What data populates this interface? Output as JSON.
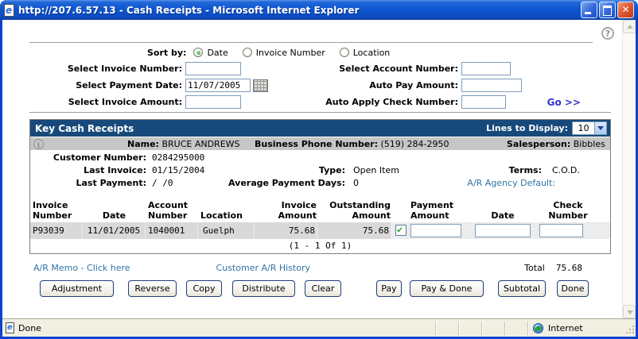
{
  "window": {
    "title": "http://207.6.57.13 - Cash Receipts - Microsoft Internet Explorer"
  },
  "icons": {
    "ie": "e",
    "help": "?",
    "info": "i"
  },
  "colors": {
    "titlebar_blue": "#0f55d0",
    "panel_header_navy": "#17497B",
    "name_bar_gray": "#C6C6C6",
    "row_gray": "#D9D9D9",
    "link_steel_blue": "#2E74A4",
    "go_link_blue": "#3333CC",
    "checkmark_green": "#2BA32B"
  },
  "sort": {
    "label": "Sort by:",
    "options": [
      {
        "label": "Date",
        "selected": true
      },
      {
        "label": "Invoice Number",
        "selected": false
      },
      {
        "label": "Location",
        "selected": false
      }
    ]
  },
  "filters": {
    "invoice_number": {
      "label": "Select Invoice Number:",
      "value": ""
    },
    "payment_date": {
      "label": "Select Payment Date:",
      "value": "11/07/2005"
    },
    "invoice_amount": {
      "label": "Select Invoice Amount:",
      "value": ""
    },
    "account_number": {
      "label": "Select Account Number:",
      "value": ""
    },
    "auto_pay_amount": {
      "label": "Auto Pay Amount:",
      "value": ""
    },
    "auto_apply_check": {
      "label": "Auto Apply Check Number:",
      "value": ""
    },
    "go_label": "Go >>"
  },
  "panel": {
    "title": "Key Cash Receipts",
    "lines_to_display": {
      "label": "Lines to Display:",
      "value": "10"
    },
    "customer": {
      "name_label": "Name:",
      "name": "BRUCE ANDREWS",
      "phone_label": "Business Phone Number:",
      "phone": "(519) 284-2950",
      "salesperson_label": "Salesperson:",
      "salesperson": "Bibbles",
      "customer_number_label": "Customer Number:",
      "customer_number": "0284295000",
      "last_invoice_label": "Last Invoice:",
      "last_invoice": "01/15/2004",
      "type_label": "Type:",
      "type": "Open Item",
      "terms_label": "Terms:",
      "terms": "C.O.D.",
      "last_payment_label": "Last Payment:",
      "last_payment": "/ /0",
      "avg_payment_days_label": "Average Payment Days:",
      "avg_payment_days": "0",
      "ar_agency_default_label": "A/R Agency Default:"
    },
    "table": {
      "headers": [
        {
          "line1": "Invoice",
          "line2": "Number"
        },
        {
          "line1": "",
          "line2": "Date"
        },
        {
          "line1": "Account",
          "line2": "Number"
        },
        {
          "line1": "",
          "line2": "Location"
        },
        {
          "line1": "Invoice",
          "line2": "Amount"
        },
        {
          "line1": "Outstanding",
          "line2": "Amount"
        },
        {
          "line1": "Payment",
          "line2": "Amount"
        },
        {
          "line1": "",
          "line2": "Date"
        },
        {
          "line1": "Check",
          "line2": "Number"
        }
      ],
      "row": {
        "invoice_number": "P93039",
        "date": "11/01/2005",
        "account_number": "1040001",
        "location": "Guelph",
        "invoice_amount": "75.68",
        "outstanding_amount": "75.68",
        "paid_checked": true,
        "payment_amount": "",
        "payment_date": "",
        "check_number": ""
      },
      "pagination": "(1 - 1 Of 1)"
    },
    "links": {
      "ar_memo": "A/R Memo - Click here",
      "customer_history": "Customer A/R History"
    },
    "total": {
      "label": "Total",
      "value": "75.68"
    }
  },
  "buttons": [
    "Adjustment",
    "Reverse",
    "Copy",
    "Distribute",
    "Clear",
    "Pay",
    "Pay & Done",
    "Subtotal",
    "Done"
  ],
  "statusbar": {
    "status": "Done",
    "zone": "Internet"
  }
}
